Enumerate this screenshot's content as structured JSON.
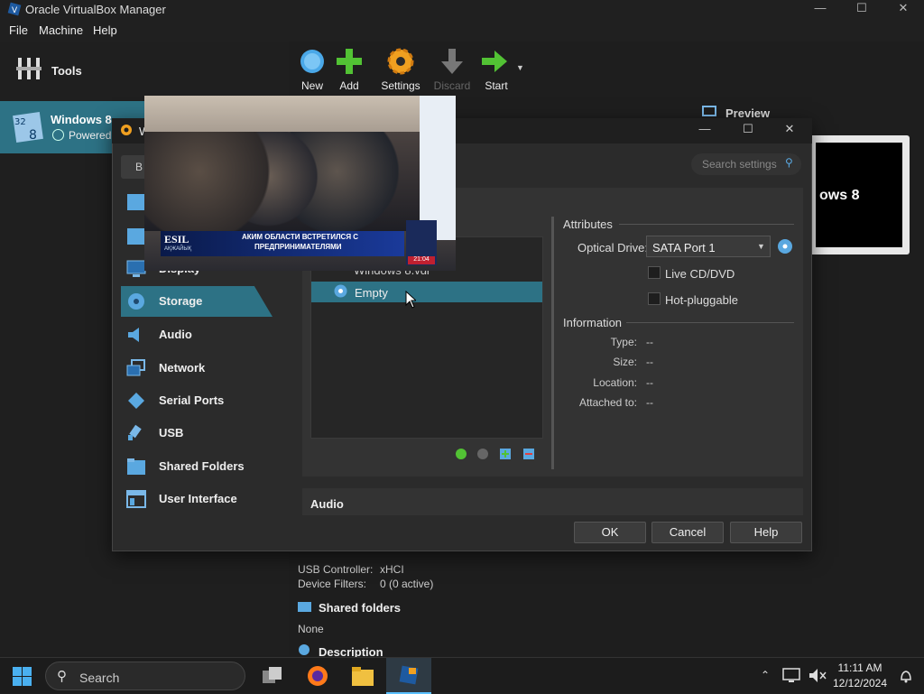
{
  "window": {
    "title": "Oracle VirtualBox Manager"
  },
  "menu": [
    "File",
    "Machine",
    "Help"
  ],
  "left_pane": {
    "tools_label": "Tools",
    "vm": {
      "name": "Windows 8",
      "state": "Powered"
    }
  },
  "toolbar": [
    {
      "label": "New",
      "icon": "new-icon"
    },
    {
      "label": "Add",
      "icon": "add-icon"
    },
    {
      "label": "Settings",
      "icon": "settings-icon"
    },
    {
      "label": "Discard",
      "icon": "discard-icon"
    },
    {
      "label": "Start",
      "icon": "start-icon"
    }
  ],
  "preview": {
    "label": "Preview",
    "screen_text": "ows 8"
  },
  "details": {
    "usb_controller_label": "USB Controller:",
    "usb_controller_value": "xHCI",
    "device_filters_label": "Device Filters:",
    "device_filters_value": "0 (0 active)",
    "shared_folders_title": "Shared folders",
    "shared_folders_value": "None",
    "description_title": "Description"
  },
  "dialog": {
    "title_initial": "W",
    "search_placeholder": "Search settings",
    "basic_tab_partial": "B",
    "sidebar": [
      {
        "label": "Display",
        "icon": "display-icon"
      },
      {
        "label": "Storage",
        "icon": "storage-icon"
      },
      {
        "label": "Audio",
        "icon": "audio-icon"
      },
      {
        "label": "Network",
        "icon": "network-icon"
      },
      {
        "label": "Serial Ports",
        "icon": "serial-ports-icon"
      },
      {
        "label": "USB",
        "icon": "usb-icon"
      },
      {
        "label": "Shared Folders",
        "icon": "shared-folders-icon"
      },
      {
        "label": "User Interface",
        "icon": "user-interface-icon"
      }
    ],
    "tree": {
      "partial_item": "Windows 8.vdi",
      "selected_item": "Empty"
    },
    "attributes": {
      "title": "Attributes",
      "optical_drive_label": "Optical Drive:",
      "optical_drive_value": "SATA Port 1",
      "live_cd_label": "Live CD/DVD",
      "hot_pluggable_label": "Hot-pluggable"
    },
    "information": {
      "title": "Information",
      "type_label": "Type:",
      "type_value": "--",
      "size_label": "Size:",
      "size_value": "--",
      "location_label": "Location:",
      "location_value": "--",
      "attached_label": "Attached to:",
      "attached_value": "--"
    },
    "audio_section": "Audio",
    "buttons": {
      "ok": "OK",
      "cancel": "Cancel",
      "help": "Help"
    }
  },
  "video_overlay": {
    "channel": "ESIL",
    "channel_sub": "АҚЖАЙЫҚ",
    "caption_line1": "АКИМ ОБЛАСТИ ВСТРЕТИЛСЯ С",
    "caption_line2": "ПРЕДПРИНИМАТЕЛЯМИ",
    "clock": "21:04"
  },
  "taskbar": {
    "search_placeholder": "Search",
    "time": "11:11 AM",
    "date": "12/12/2024"
  }
}
